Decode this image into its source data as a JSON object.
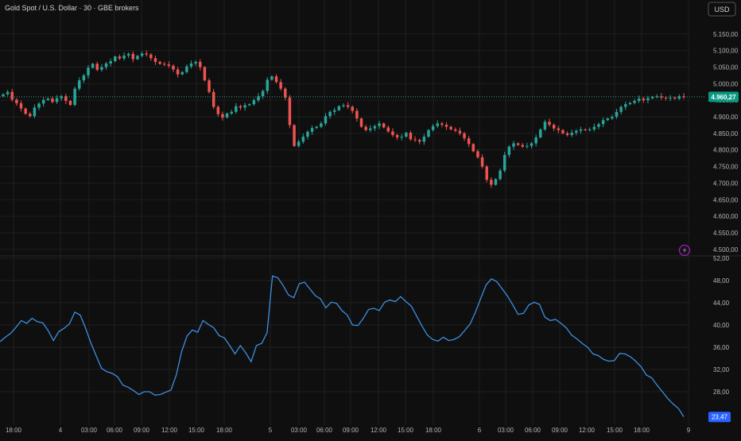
{
  "header": {
    "title": "Gold Spot / U.S. Dollar · 30 · GBE brokers",
    "currency_button": "USD"
  },
  "colors": {
    "background": "#0f0f0f",
    "grid": "#1f1f1f",
    "up": "#26a69a",
    "down": "#ef5350",
    "oscillator": "#3d8fe0",
    "axis_text": "#b2b5be",
    "price_tag": "#089981",
    "osc_tag": "#2962ff",
    "lightning": "#9c27b0"
  },
  "icons": {
    "alert": "lightning-icon"
  },
  "chart_data": [
    {
      "type": "candlestick",
      "title": "Gold Spot / U.S. Dollar · 30 · GBE brokers",
      "x_tick_labels": [
        "18:00",
        "4",
        "03:00",
        "06:00",
        "09:00",
        "12:00",
        "15:00",
        "18:00",
        "5",
        "03:00",
        "06:00",
        "09:00",
        "12:00",
        "15:00",
        "18:00",
        "6",
        "03:00",
        "06:00",
        "09:00",
        "12:00",
        "15:00",
        "18:00",
        "9"
      ],
      "y_tick_labels": [
        "5.150,00",
        "5.100,00",
        "5.050,00",
        "5.000,00",
        "4.950,00",
        "4.900,00",
        "4.850,00",
        "4.800,00",
        "4.750,00",
        "4.700,00",
        "4.650,00",
        "4.600,00",
        "4.550,00",
        "4.500,00"
      ],
      "ylim": [
        4490,
        5195
      ],
      "y_ticks": [
        5150,
        5100,
        5050,
        5000,
        4950,
        4900,
        4850,
        4800,
        4750,
        4700,
        4650,
        4600,
        4550,
        4500
      ],
      "last_price": 4960.27,
      "last_price_label": "4.960,27",
      "closes": [
        4968,
        4975,
        4952,
        4941,
        4925,
        4909,
        4902,
        4928,
        4940,
        4951,
        4955,
        4945,
        4956,
        4962,
        4948,
        4936,
        4985,
        5010,
        5025,
        5048,
        5060,
        5042,
        5050,
        5061,
        5068,
        5082,
        5076,
        5085,
        5090,
        5074,
        5084,
        5091,
        5088,
        5077,
        5066,
        5060,
        5058,
        5054,
        5043,
        5028,
        5035,
        5052,
        5061,
        5066,
        5050,
        5010,
        4975,
        4930,
        4908,
        4898,
        4910,
        4915,
        4932,
        4928,
        4935,
        4938,
        4950,
        4962,
        4978,
        5012,
        5022,
        5005,
        4985,
        4958,
        4875,
        4812,
        4825,
        4840,
        4855,
        4866,
        4870,
        4880,
        4902,
        4915,
        4920,
        4932,
        4935,
        4930,
        4918,
        4895,
        4870,
        4860,
        4865,
        4872,
        4880,
        4868,
        4856,
        4845,
        4838,
        4840,
        4852,
        4832,
        4830,
        4825,
        4840,
        4860,
        4872,
        4880,
        4876,
        4870,
        4862,
        4858,
        4850,
        4835,
        4818,
        4796,
        4778,
        4750,
        4710,
        4695,
        4712,
        4738,
        4785,
        4810,
        4820,
        4815,
        4810,
        4812,
        4820,
        4838,
        4862,
        4885,
        4876,
        4865,
        4860,
        4850,
        4845,
        4852,
        4858,
        4862,
        4860,
        4862,
        4870,
        4878,
        4890,
        4895,
        4900,
        4915,
        4930,
        4938,
        4942,
        4948,
        4955,
        4950,
        4956,
        4960,
        4962,
        4958,
        4957,
        4958,
        4955,
        4962,
        4960
      ]
    },
    {
      "type": "line",
      "name": "",
      "y_tick_labels": [
        "52,00",
        "48,00",
        "44,00",
        "40,00",
        "36,00",
        "32,00",
        "28,00"
      ],
      "ylim": [
        23.0,
        52.0
      ],
      "y_ticks": [
        52,
        48,
        44,
        40,
        36,
        32,
        28
      ],
      "last_value": 23.47,
      "last_value_label": "23,47",
      "values": [
        37.0,
        37.8,
        38.5,
        39.6,
        40.8,
        40.3,
        41.2,
        40.6,
        40.4,
        39.0,
        37.2,
        38.8,
        39.4,
        40.2,
        42.3,
        41.8,
        39.5,
        36.8,
        34.5,
        32.2,
        31.6,
        31.3,
        30.7,
        29.2,
        28.8,
        28.2,
        27.5,
        28.0,
        28.0,
        27.4,
        27.5,
        27.9,
        28.3,
        31.0,
        35.2,
        38.0,
        39.1,
        38.7,
        40.8,
        40.1,
        39.5,
        38.1,
        37.7,
        36.3,
        34.8,
        36.3,
        35.0,
        33.4,
        36.3,
        36.7,
        38.6,
        48.8,
        48.5,
        47.1,
        45.4,
        44.9,
        47.4,
        47.7,
        46.5,
        45.3,
        44.7,
        43.1,
        44.1,
        43.9,
        42.6,
        41.8,
        40.0,
        39.9,
        41.2,
        42.8,
        43.0,
        42.6,
        44.1,
        44.5,
        44.2,
        45.1,
        44.2,
        43.4,
        41.6,
        39.8,
        38.2,
        37.4,
        37.1,
        37.8,
        37.2,
        37.4,
        37.9,
        39.0,
        40.2,
        42.3,
        44.8,
        47.2,
        48.3,
        47.8,
        46.5,
        45.2,
        43.6,
        41.9,
        42.1,
        43.6,
        44.1,
        43.7,
        41.4,
        40.8,
        41.0,
        40.3,
        39.5,
        38.2,
        37.5,
        36.7,
        36.0,
        34.8,
        34.5,
        33.8,
        33.5,
        33.6,
        34.9,
        34.8,
        34.3,
        33.5,
        32.5,
        31.0,
        30.5,
        29.2,
        28.0,
        26.8,
        25.8,
        25.0,
        23.5
      ]
    }
  ]
}
